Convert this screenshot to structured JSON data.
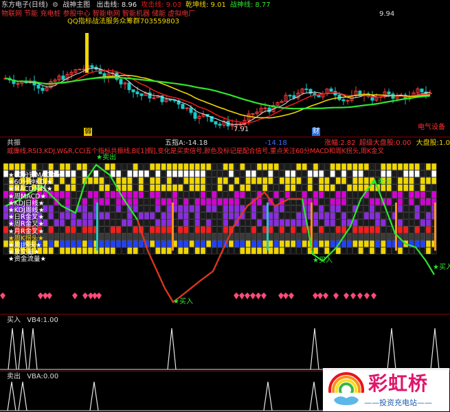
{
  "main": {
    "title": "东方电子(日线)",
    "indicator_name": "战神主图",
    "items": [
      {
        "label": "出击线:",
        "value": "8.96",
        "color": "#e6e6e6"
      },
      {
        "label": "攻击线:",
        "value": "9.03",
        "color": "#e51b1b"
      },
      {
        "label": "乾坤线:",
        "value": "9.01",
        "color": "#f0d700"
      },
      {
        "label": "战神线:",
        "value": "8.77",
        "color": "#2ee62e"
      }
    ],
    "concept_tags": "物联网 节能 充电桩 参股中心 智能电网 智能机器 储能 虚拟电厂",
    "qq_text": "QQ指标战法服务众筹群703559803",
    "high_label": "9.94",
    "low_label": "7.91",
    "marker_left": "弱",
    "marker_right": "财",
    "sector_tag": "电气设备"
  },
  "mid": {
    "name": "共振",
    "five_index_label": "五指A:",
    "five_index_value": "-14.18",
    "five_index_b": "-14.18",
    "raise_label": "涨幅:",
    "raise_value": "2.82",
    "super_label": "超级大盘股:",
    "super_value": "0.00",
    "bigcap_label": "大盘股:",
    "bigcap_value": "1.00",
    "legend_text": "威廉线,RSI3,KDJ,W&R,CCI五个指标共振线,BI[1]假],变化是买卖信号,颜色及标记是配合信号,重点关注60分MACD和周K拐头,周K金叉",
    "signal_buy": "买入",
    "signal_sell": "卖出",
    "row_labels": [
      "★60分钟MACD★",
      "★60分钟KDJ★",
      "★MACD月线★",
      "★周MACD★",
      "★KDJ日线★",
      "★KDJ周线★",
      "★日R金叉★",
      "★周R金叉★",
      "★月R金叉★",
      "★周K拐头★",
      "★周J拐头★",
      "★放交量★",
      "★资金流量★"
    ]
  },
  "sub1": {
    "name": "买入",
    "label": "VB4:",
    "value": "1.00"
  },
  "sub2": {
    "name": "卖出",
    "label": "VBA:",
    "value": "0.00"
  },
  "brand": {
    "name": "彩虹桥",
    "subtitle": "——投资充电站——"
  },
  "colors": {
    "bg": "#000000",
    "up": "#ff3b3b",
    "down": "#1ec8c8",
    "attack": "#e51b1b",
    "qiankun": "#f0d700",
    "zhanshen": "#2ee62e"
  }
}
